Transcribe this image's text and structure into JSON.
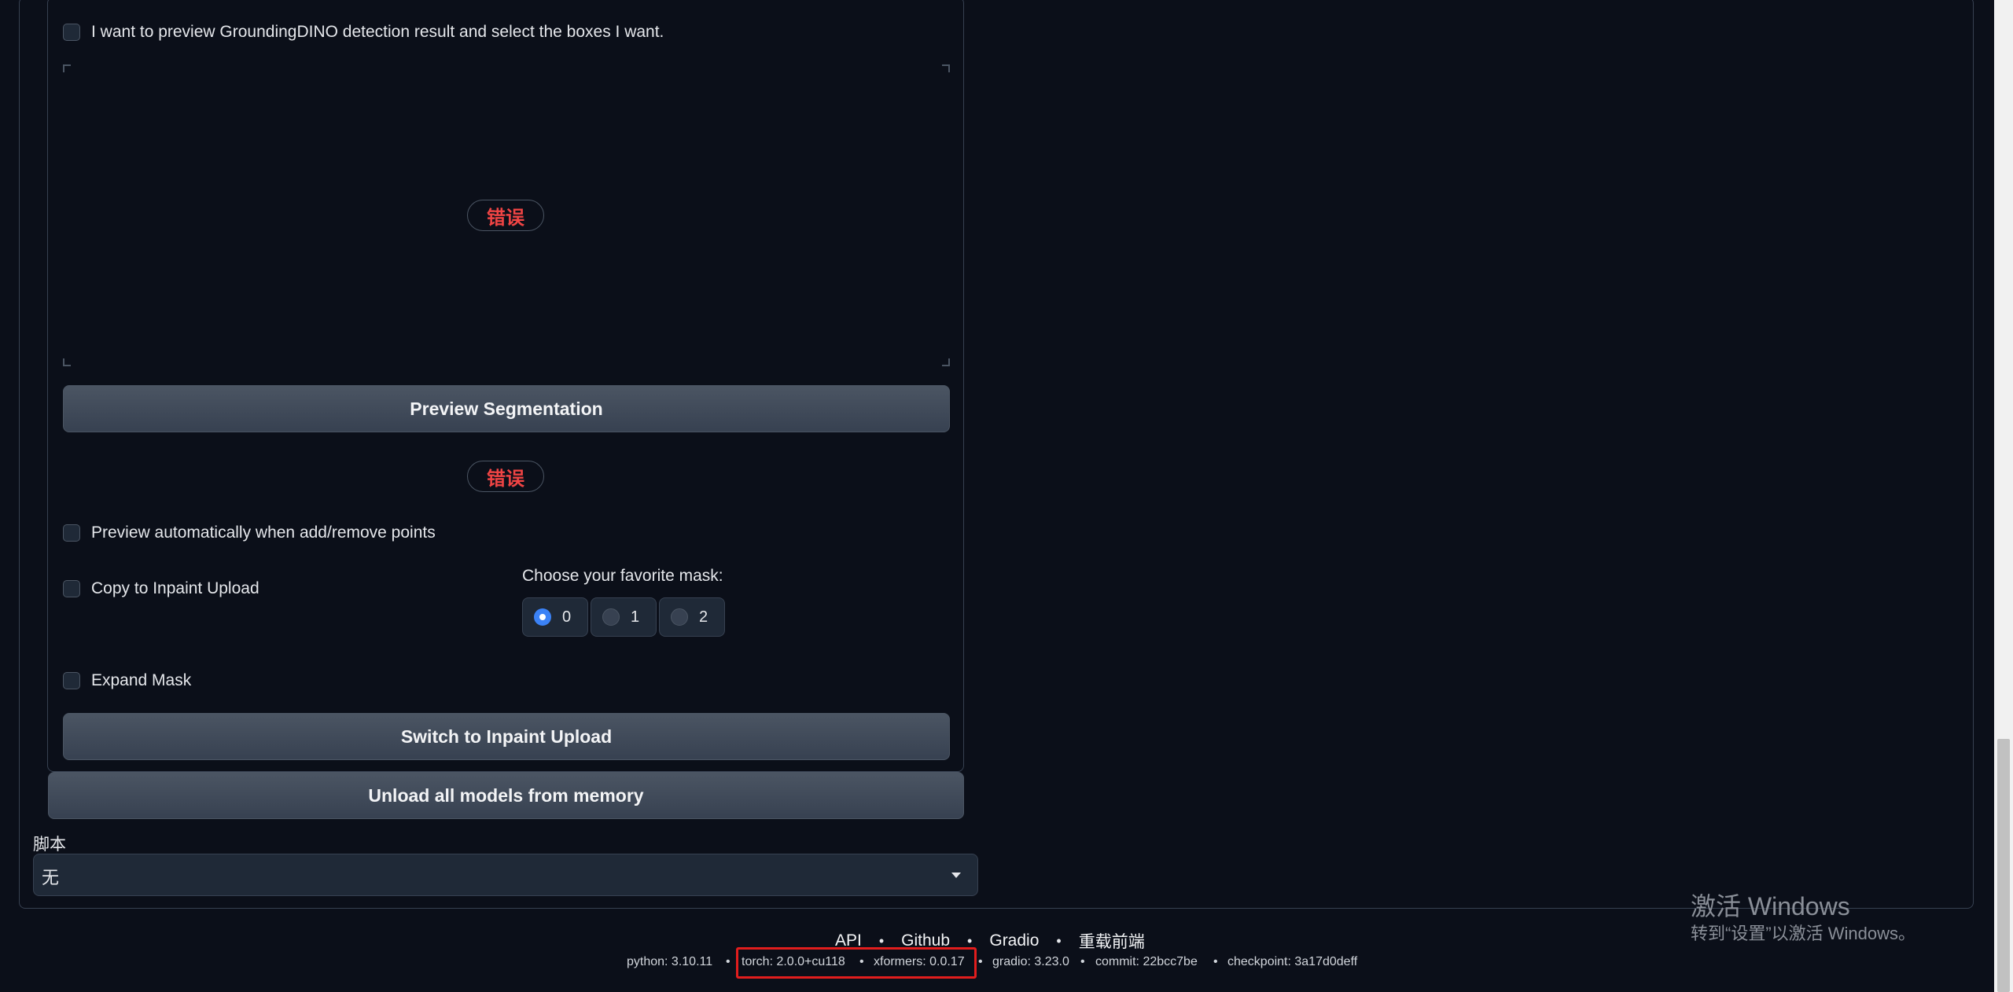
{
  "detection": {
    "preview_checkbox_label": "I want to preview GroundingDINO detection result and select the boxes I want.",
    "error_label": "错误"
  },
  "segmentation": {
    "preview_button": "Preview Segmentation",
    "error_label": "错误",
    "auto_preview_label": "Preview automatically when add/remove points",
    "copy_inpaint_label": "Copy to Inpaint Upload",
    "mask_choice_label": "Choose your favorite mask:",
    "mask_options": [
      "0",
      "1",
      "2"
    ],
    "mask_selected": "0",
    "expand_mask_label": "Expand Mask",
    "switch_button": "Switch to Inpaint Upload"
  },
  "unload_button": "Unload all models from memory",
  "script": {
    "label": "脚本",
    "value": "无"
  },
  "footer": {
    "links": [
      "API",
      "Github",
      "Gradio",
      "重载前端"
    ],
    "separator": "•",
    "info": {
      "python": "python: 3.10.11",
      "torch": "torch: 2.0.0+cu118",
      "xformers": "xformers: 0.0.17",
      "gradio": "gradio: 3.23.0",
      "commit": "commit: 22bcc7be",
      "checkpoint": "checkpoint: 3a17d0deff"
    },
    "highlight_color": "#e11d1d"
  },
  "watermark": {
    "title": "激活 Windows",
    "subtitle": "转到“设置”以激活 Windows。"
  },
  "colors": {
    "background": "#0b0f19",
    "button": "#4b5563",
    "error": "#ef4444",
    "radio_checked": "#3b82f6"
  }
}
